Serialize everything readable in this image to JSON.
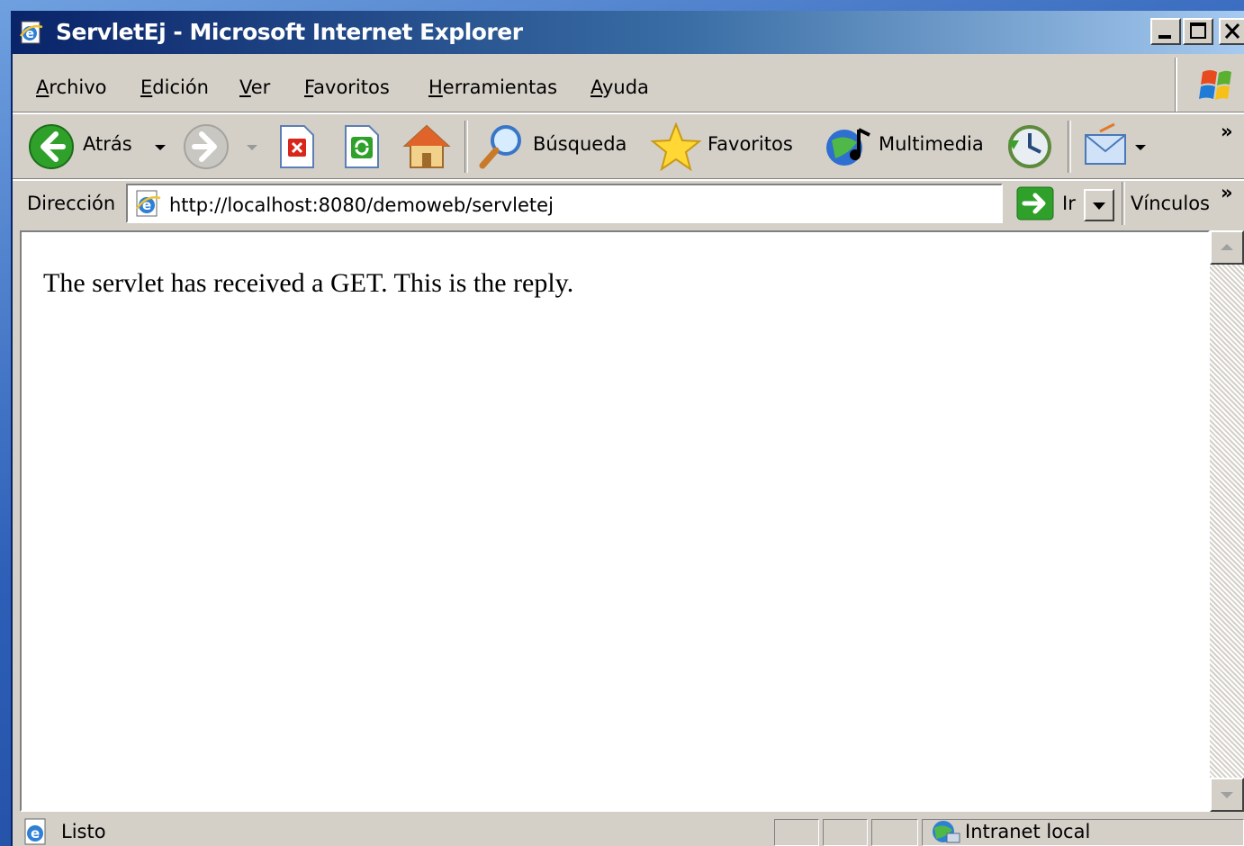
{
  "window": {
    "title": "ServletEj - Microsoft Internet Explorer"
  },
  "menu": {
    "items": [
      "Archivo",
      "Edición",
      "Ver",
      "Favoritos",
      "Herramientas",
      "Ayuda"
    ]
  },
  "toolbar": {
    "back_label": "Atrás",
    "search_label": "Búsqueda",
    "favorites_label": "Favoritos",
    "media_label": "Multimedia",
    "chevron": "»"
  },
  "address": {
    "label": "Dirección",
    "url": "http://localhost:8080/demoweb/servletej",
    "go_label": "Ir",
    "links_label": "Vínculos",
    "chevron": "»"
  },
  "page": {
    "body_text": "The servlet has received a GET. This is the reply."
  },
  "status": {
    "text": "Listo",
    "zone": "Intranet local"
  },
  "colors": {
    "title_start": "#0a246a",
    "title_end": "#a6caf0",
    "chrome": "#d4d0c8"
  }
}
